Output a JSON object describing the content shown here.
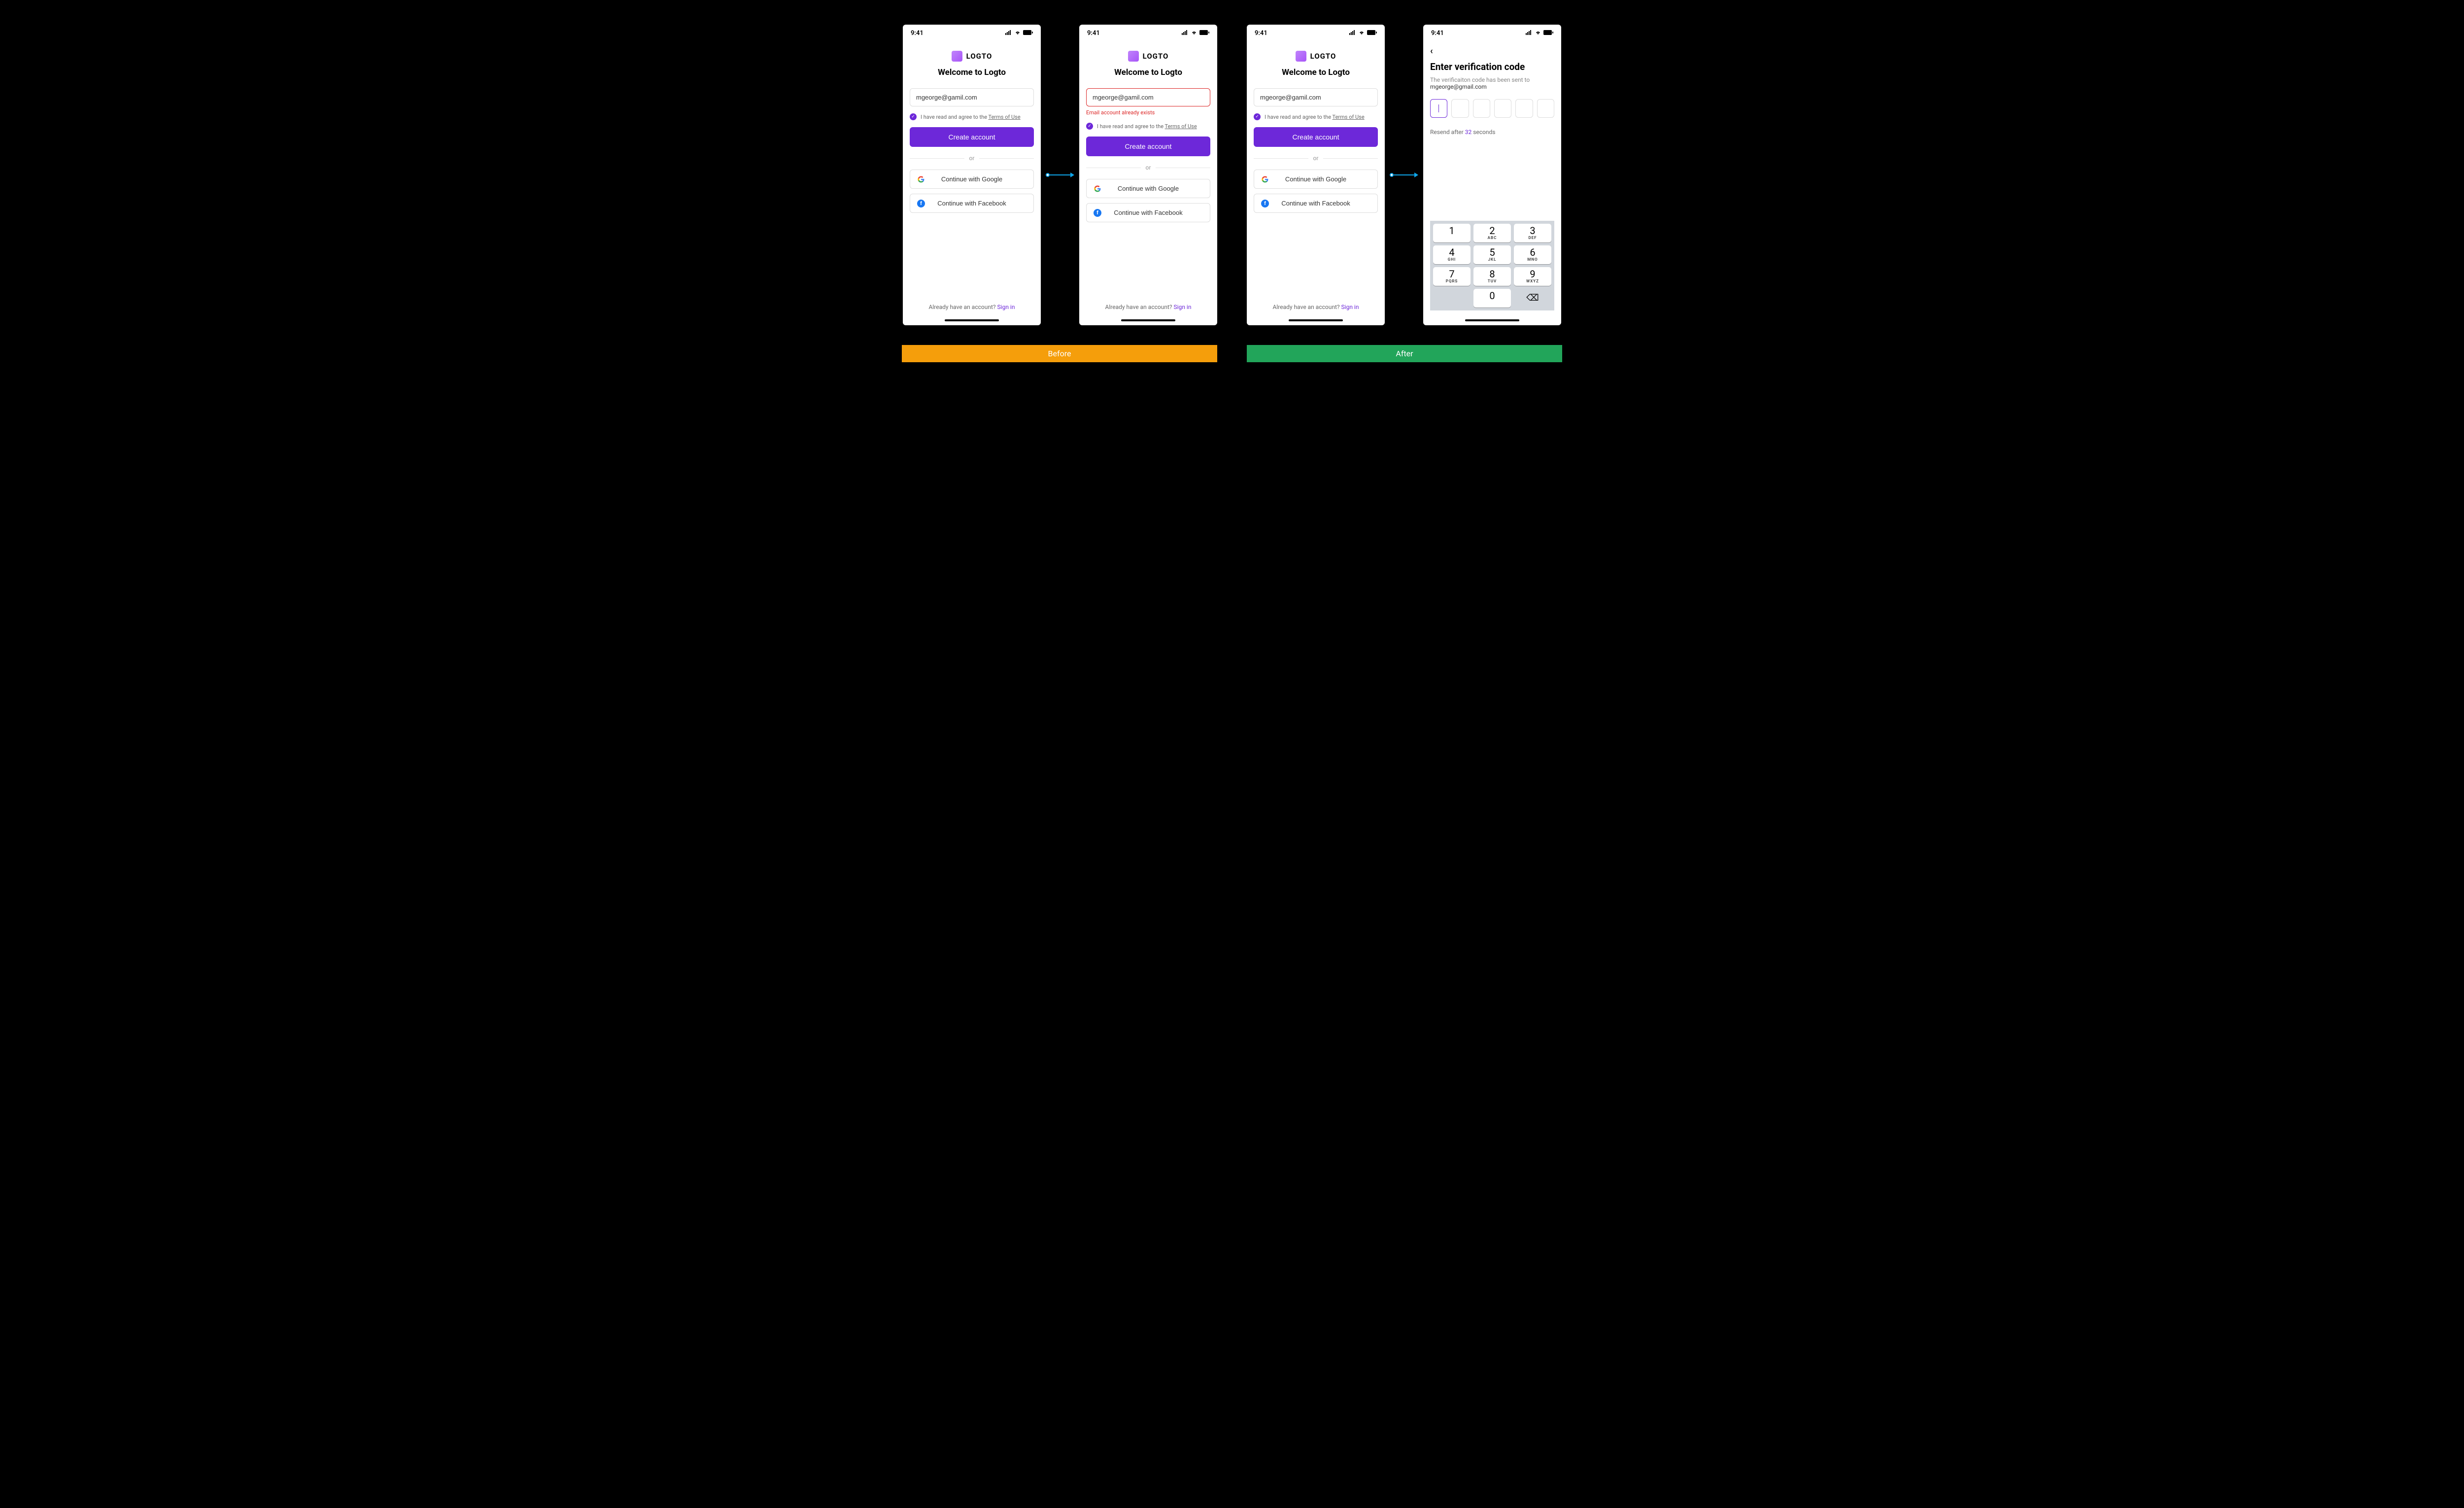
{
  "status": {
    "time": "9:41"
  },
  "brand": {
    "name": "LOGTO"
  },
  "welcome": "Welcome to Logto",
  "input": {
    "value": "mgeorge@gamil.com"
  },
  "error": "Email account already exists",
  "terms": {
    "prefix": "I have read and agree to the ",
    "link": "Terms of Use"
  },
  "cta": {
    "label": "Create account"
  },
  "divider": "or",
  "social": {
    "google": "Continue with Google",
    "facebook": "Continue with Facebook"
  },
  "footer": {
    "prompt": "Already have an account? ",
    "link": "Sign in"
  },
  "verify": {
    "title": "Enter verification code",
    "subtitle": "The verificaiton code has been sent to",
    "email": "mgeorge@gmail.com",
    "resend_prefix": "Resend after ",
    "resend_seconds": "32",
    "resend_suffix": " seconds"
  },
  "keypad": {
    "k1": "1",
    "k2": "2",
    "k2l": "ABC",
    "k3": "3",
    "k3l": "DEF",
    "k4": "4",
    "k4l": "GHI",
    "k5": "5",
    "k5l": "JKL",
    "k6": "6",
    "k6l": "MNO",
    "k7": "7",
    "k7l": "PQRS",
    "k8": "8",
    "k8l": "TUV",
    "k9": "9",
    "k9l": "WXYZ",
    "k0": "0"
  },
  "labels": {
    "before": "Before",
    "after": "After"
  }
}
